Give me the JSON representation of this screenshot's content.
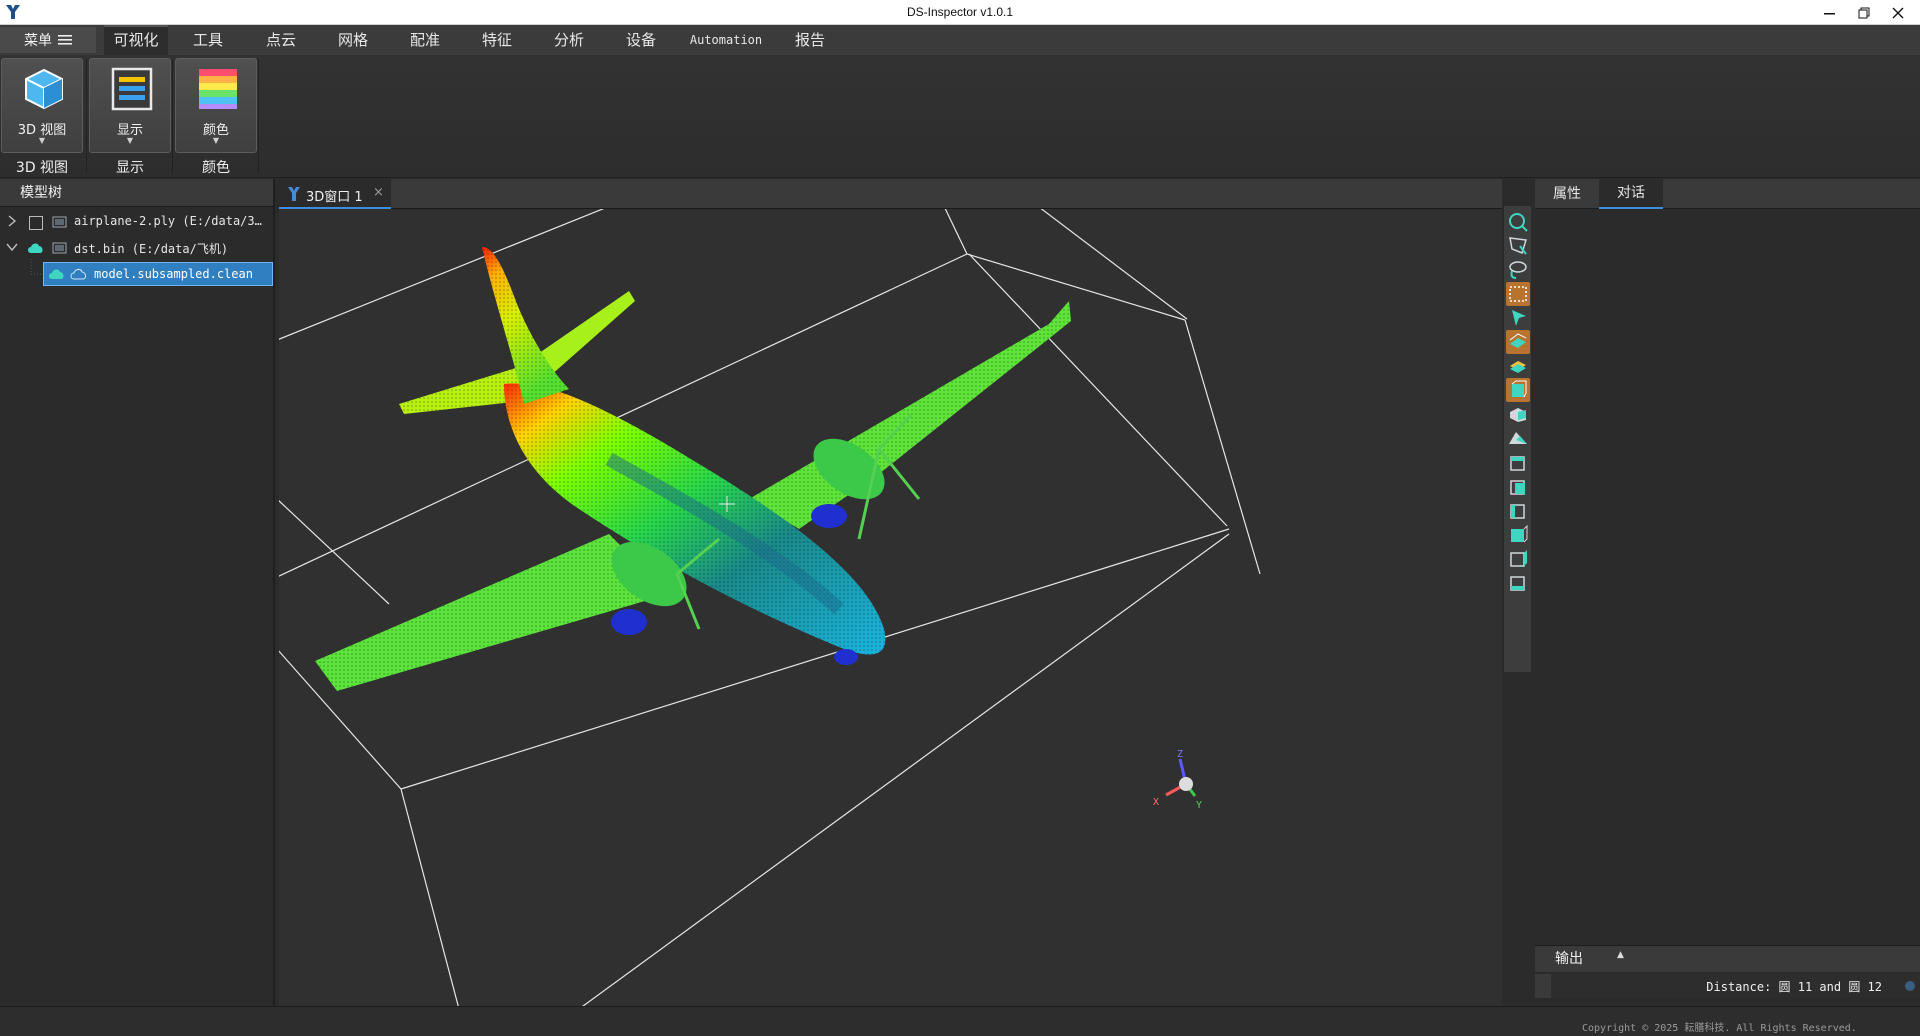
{
  "window": {
    "title": "DS-Inspector v1.0.1",
    "controls": [
      "minimize-icon",
      "restore-icon",
      "close-icon"
    ]
  },
  "menubar": {
    "main_menu": "菜单",
    "items": [
      "可视化",
      "工具",
      "点云",
      "网格",
      "配准",
      "特征",
      "分析",
      "设备",
      "Automation",
      "报告"
    ],
    "active": "可视化"
  },
  "ribbon": {
    "groups": [
      {
        "button_label": "3D 视图",
        "caption": "3D 视图",
        "icon": "cube-icon"
      },
      {
        "button_label": "显示",
        "caption": "显示",
        "icon": "display-layers-icon"
      },
      {
        "button_label": "颜色",
        "caption": "颜色",
        "icon": "color-palette-icon"
      }
    ]
  },
  "model_tree": {
    "title": "模型树",
    "items": [
      {
        "label": "airplane-2.ply (E:/data/3…",
        "expanded": false,
        "checked": false
      },
      {
        "label": "dst.bin (E:/data/飞机)",
        "expanded": true,
        "visible": true
      },
      {
        "label": "model.subsampled.clean",
        "selected": true
      }
    ]
  },
  "viewport": {
    "tab_label": "3D窗口 1",
    "close_glyph": "×",
    "axis_labels": {
      "x": "X",
      "y": "Y",
      "z": "Z"
    }
  },
  "toolstrip": {
    "tools": [
      "zoom-fit-icon",
      "polygon-select-icon",
      "lasso-select-icon",
      "rect-select-icon",
      "pointer-icon",
      "view-top-icon",
      "view-layer-icon",
      "view-front-icon",
      "view-side-icon",
      "view-iso-icon",
      "view-back-icon",
      "view-left-icon",
      "view-right-icon",
      "view-bottom-icon",
      "view-persp-icon",
      "view-ortho-icon"
    ]
  },
  "right_panel": {
    "tabs": [
      "属性",
      "对话"
    ],
    "active_tab": "对话",
    "output_title": "输出",
    "output_caret": "▲",
    "output_text": "Distance: 圆 11 and 圆 12"
  },
  "statusbar": {
    "copyright": "Copyright © 2025 耘膳科技. All Rights Reserved."
  },
  "colors": {
    "accent": "#3c8fe0",
    "selection": "#2f7fc1",
    "icon_teal": "#3ed6c0",
    "icon_orange": "#c27a35"
  }
}
